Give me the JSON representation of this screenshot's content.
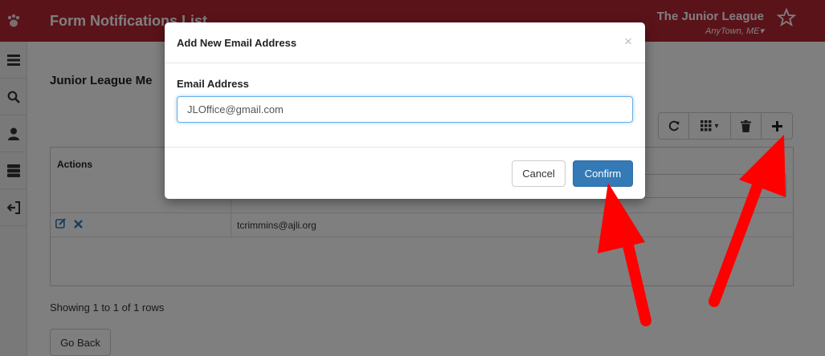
{
  "header": {
    "title": "Form Notifications List",
    "org_name": "The Junior League",
    "org_location": "AnyTown, ME",
    "background_color": "#b52633"
  },
  "sidebar": {
    "items": [
      {
        "icon": "menu-icon"
      },
      {
        "icon": "search-icon"
      },
      {
        "icon": "user-icon"
      },
      {
        "icon": "database-icon"
      },
      {
        "icon": "sign-out-icon"
      }
    ]
  },
  "main": {
    "heading": "Junior League Me",
    "toolbar": [
      "refresh-icon",
      "columns-icon",
      "trash-icon",
      "plus-icon"
    ],
    "table": {
      "headers": [
        "Actions",
        ""
      ],
      "rows": [
        {
          "email": "tcrimmins@ajli.org"
        }
      ]
    },
    "showing": "Showing 1 to 1 of 1 rows",
    "go_back": "Go Back"
  },
  "modal": {
    "title": "Add New Email Address",
    "close": "×",
    "field_label": "Email Address",
    "field_value": "JLOffice@gmail.com",
    "cancel": "Cancel",
    "confirm": "Confirm",
    "confirm_color": "#337ab7"
  },
  "annotation": {
    "arrow_color": "#ff0000"
  }
}
